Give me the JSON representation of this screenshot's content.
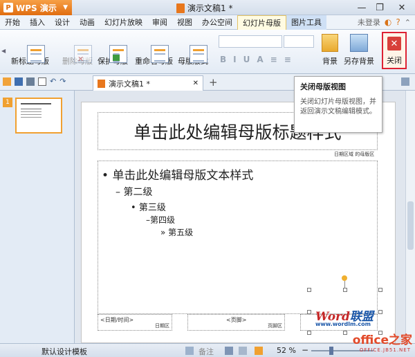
{
  "app": {
    "name": "WPS 演示",
    "doc_title": "演示文稿1 *"
  },
  "window_controls": {
    "minimize": "—",
    "restore": "❐",
    "close": "✕"
  },
  "menu": {
    "items": [
      "开始",
      "插入",
      "设计",
      "动画",
      "幻灯片放映",
      "审阅",
      "视图",
      "办公空间",
      "幻灯片母版",
      "图片工具"
    ],
    "active": "幻灯片母版",
    "login": "未登录"
  },
  "ribbon": {
    "new_title_master": "新标题母版",
    "delete_master": "删除母版",
    "protect_master": "保护母版",
    "rename_master": "重命名母版",
    "master_layout": "母版版式",
    "format_buttons": [
      "B",
      "I",
      "U",
      "A",
      "≡",
      "≡"
    ],
    "background": "背景",
    "save_background": "另存背景",
    "close": "关闭"
  },
  "tabs": {
    "doc_tab": "演示文稿1 *",
    "add": "+"
  },
  "tooltip": {
    "title": "关闭母版视图",
    "body": "关闭幻灯片母版视图，并返回演示文稿编辑模式。"
  },
  "thumbnail": {
    "number": "1"
  },
  "slide": {
    "title_placeholder": "单击此处编辑母版标题样式",
    "title_area_label": "日期区域 的母版区",
    "levels": [
      "单击此处编辑母版文本样式",
      "第二级",
      "第三级",
      "第四级",
      "第五级"
    ],
    "bullets": [
      "•",
      "–",
      "•",
      "–",
      "»"
    ],
    "footer_date": "<日期/时间>",
    "footer_date_label": "日期区",
    "footer_page": "<页脚>",
    "footer_page_label": "页脚区",
    "watermark_a": "Word",
    "watermark_b": "联盟",
    "watermark_url": "www.wordlm.com"
  },
  "status": {
    "template": "默认设计模板",
    "notes": "备注",
    "zoom": "52 %"
  },
  "brand": {
    "name": "office之家",
    "url": "OFFICE.JB51.NET"
  },
  "colors": {
    "accent": "#f0a030",
    "close_red": "#d8403a",
    "brand_red": "#e24a2a"
  }
}
